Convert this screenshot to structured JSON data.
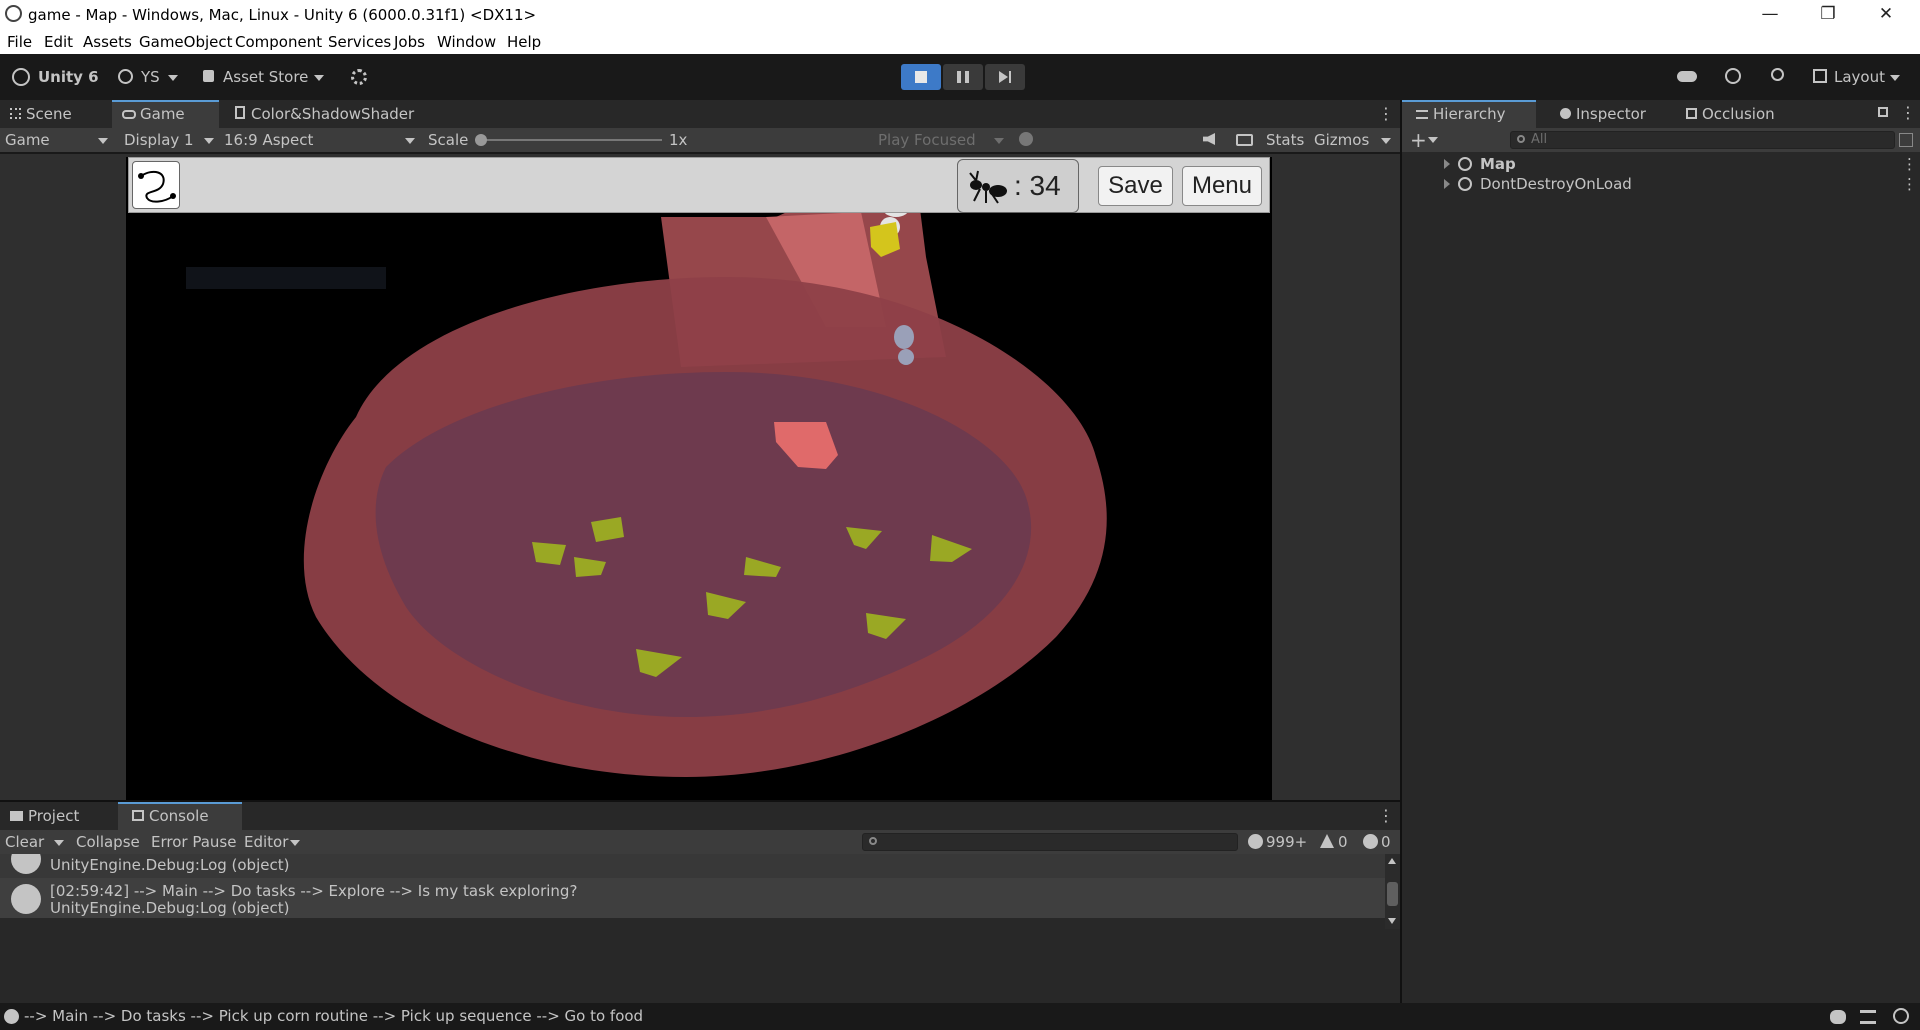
{
  "window": {
    "title": "game - Map - Windows, Mac, Linux - Unity 6 (6000.0.31f1) <DX11>",
    "minimize": "—",
    "maximize": "❐",
    "close": "✕"
  },
  "menu": [
    "File",
    "Edit",
    "Assets",
    "GameObject",
    "Component",
    "Services",
    "Jobs",
    "Window",
    "Help"
  ],
  "toolbar": {
    "unity_label": "Unity 6",
    "account": "YS",
    "asset_store": "Asset Store",
    "layout": "Layout"
  },
  "scene_tabs": {
    "scene": "Scene",
    "game": "Game",
    "shader": "Color&ShadowShader"
  },
  "game_bar": {
    "view_select": "Game",
    "display": "Display 1",
    "aspect": "16:9 Aspect",
    "scale_label": "Scale",
    "scale_value": "1x",
    "scale_fraction": 0.0,
    "play_mode": "Play Focused",
    "stats": "Stats",
    "gizmos": "Gizmos"
  },
  "hud": {
    "ant_count": ": 34",
    "save": "Save",
    "menu": "Menu"
  },
  "hierarchy": {
    "tabs": [
      "Hierarchy",
      "Inspector",
      "Occlusion"
    ],
    "search_placeholder": "All",
    "items": [
      "Map",
      "DontDestroyOnLoad"
    ]
  },
  "bottom_tabs": {
    "project": "Project",
    "console": "Console"
  },
  "console": {
    "clear": "Clear",
    "collapse": "Collapse",
    "error_pause": "Error Pause",
    "editor": "Editor",
    "count_info": "999+",
    "count_warn": "0",
    "count_error": "0",
    "logs": [
      {
        "line1": "",
        "line2": "UnityEngine.Debug:Log (object)"
      },
      {
        "line1": "[02:59:42]  --> Main --> Do tasks --> Explore --> Is my task exploring?",
        "line2": "UnityEngine.Debug:Log (object)"
      }
    ]
  },
  "status": {
    "message": " --> Main --> Do tasks --> Pick up corn routine --> Pick up sequence --> Go to food"
  },
  "colors": {
    "accent": "#5a9bd5",
    "play_active": "#3d7ac8"
  }
}
